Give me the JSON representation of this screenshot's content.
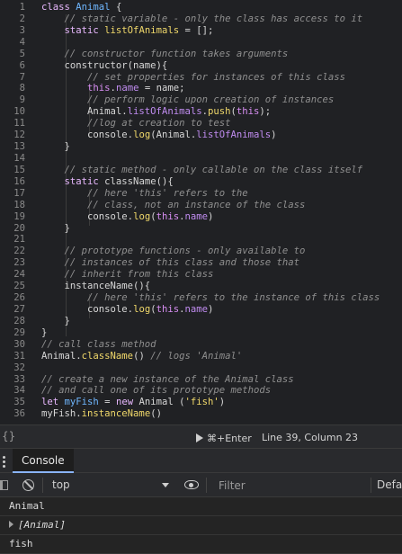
{
  "editor": {
    "line_numbers": [
      "1",
      "2",
      "3",
      "4",
      "5",
      "6",
      "7",
      "8",
      "9",
      "10",
      "11",
      "12",
      "13",
      "14",
      "15",
      "16",
      "17",
      "18",
      "19",
      "20",
      "21",
      "22",
      "23",
      "24",
      "25",
      "26",
      "27",
      "28",
      "29",
      "30",
      "31",
      "32",
      "33",
      "34",
      "35",
      "36"
    ],
    "lines": [
      [
        [
          "kw",
          "class "
        ],
        [
          "var",
          "Animal"
        ],
        [
          "pun",
          " {"
        ]
      ],
      [
        [
          "cm",
          "    // static variable - only the class has access to it"
        ]
      ],
      [
        [
          "kw",
          "    static "
        ],
        [
          "fn",
          "listOfAnimals"
        ],
        [
          "pun",
          " = [];"
        ]
      ],
      [
        [
          "pun",
          ""
        ]
      ],
      [
        [
          "cm",
          "    // constructor function takes arguments"
        ]
      ],
      [
        [
          "pun",
          "    constructor(name){"
        ]
      ],
      [
        [
          "cm",
          "        // set properties for instances of this class"
        ]
      ],
      [
        [
          "this",
          "        this"
        ],
        [
          "pun",
          "."
        ],
        [
          "prop",
          "name"
        ],
        [
          "pun",
          " = name;"
        ]
      ],
      [
        [
          "cm",
          "        // perform logic upon creation of instances"
        ]
      ],
      [
        [
          "pun",
          "        Animal."
        ],
        [
          "prop",
          "listOfAnimals"
        ],
        [
          "pun",
          "."
        ],
        [
          "fn",
          "push"
        ],
        [
          "pun",
          "("
        ],
        [
          "this",
          "this"
        ],
        [
          "pun",
          ");"
        ]
      ],
      [
        [
          "cm",
          "        //log at creation to test"
        ]
      ],
      [
        [
          "pun",
          "        console."
        ],
        [
          "fn",
          "log"
        ],
        [
          "pun",
          "(Animal."
        ],
        [
          "prop",
          "listOfAnimals"
        ],
        [
          "pun",
          ")"
        ]
      ],
      [
        [
          "pun",
          "    }"
        ]
      ],
      [
        [
          "pun",
          ""
        ]
      ],
      [
        [
          "cm",
          "    // static method - only callable on the class itself"
        ]
      ],
      [
        [
          "kw",
          "    static "
        ],
        [
          "pun",
          "className(){"
        ]
      ],
      [
        [
          "cm",
          "        // here 'this' refers to the"
        ]
      ],
      [
        [
          "cm",
          "        // class, not an instance of the class"
        ]
      ],
      [
        [
          "pun",
          "        console."
        ],
        [
          "fn",
          "log"
        ],
        [
          "pun",
          "("
        ],
        [
          "this",
          "this"
        ],
        [
          "pun",
          "."
        ],
        [
          "prop",
          "name"
        ],
        [
          "pun",
          ")"
        ]
      ],
      [
        [
          "pun",
          "    }"
        ]
      ],
      [
        [
          "pun",
          ""
        ]
      ],
      [
        [
          "cm",
          "    // prototype functions - only available to"
        ]
      ],
      [
        [
          "cm",
          "    // instances of this class and those that"
        ]
      ],
      [
        [
          "cm",
          "    // inherit from this class"
        ]
      ],
      [
        [
          "pun",
          "    instanceName(){"
        ]
      ],
      [
        [
          "cm",
          "        // here 'this' refers to the instance of this class"
        ]
      ],
      [
        [
          "pun",
          "        console."
        ],
        [
          "fn",
          "log"
        ],
        [
          "pun",
          "("
        ],
        [
          "this",
          "this"
        ],
        [
          "pun",
          "."
        ],
        [
          "prop",
          "name"
        ],
        [
          "pun",
          ")"
        ]
      ],
      [
        [
          "pun",
          "    }"
        ]
      ],
      [
        [
          "pun",
          "}"
        ]
      ],
      [
        [
          "cm",
          "// call class method"
        ]
      ],
      [
        [
          "pun",
          "Animal."
        ],
        [
          "fn",
          "className"
        ],
        [
          "pun",
          "() "
        ],
        [
          "cm",
          "// logs 'Animal'"
        ]
      ],
      [
        [
          "pun",
          ""
        ]
      ],
      [
        [
          "cm",
          "// create a new instance of the Animal class"
        ]
      ],
      [
        [
          "cm",
          "// and call one of its prototype methods"
        ]
      ],
      [
        [
          "kw",
          "let "
        ],
        [
          "var",
          "myFish"
        ],
        [
          "pun",
          " = "
        ],
        [
          "kw",
          "new "
        ],
        [
          "pun",
          "Animal ("
        ],
        [
          "str",
          "'fish'"
        ],
        [
          "pun",
          ")"
        ]
      ],
      [
        [
          "pun",
          "myFish."
        ],
        [
          "fn",
          "instanceName"
        ],
        [
          "pun",
          "()"
        ]
      ]
    ]
  },
  "status": {
    "brace": "{}",
    "run_label": "⌘+Enter",
    "cursor_position": "Line 39, Column 23"
  },
  "panel": {
    "tab_label": "Console"
  },
  "toolbar": {
    "context": "top",
    "filter_placeholder": "Filter",
    "levels_label": "Defa"
  },
  "console_output": [
    {
      "text": "Animal",
      "expandable": false
    },
    {
      "text": "[Animal]",
      "expandable": true
    },
    {
      "text": "fish",
      "expandable": false
    }
  ],
  "colors": {
    "accent": "#8ab4f8",
    "keyword": "#e9b9ff",
    "comment": "#8f8f8f",
    "function": "#f0d86a",
    "variable": "#6fb7ff"
  }
}
